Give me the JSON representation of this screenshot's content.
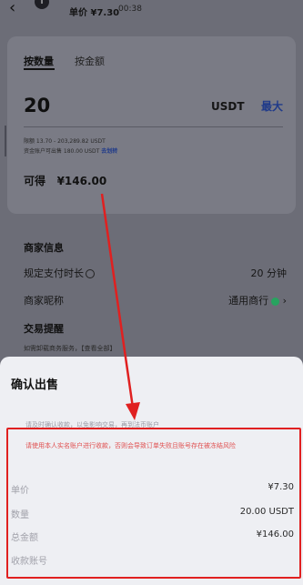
{
  "header": {
    "back_icon": "‹",
    "info_icon": "i",
    "unit_price": "单价 ¥7.30",
    "timer": "00:38"
  },
  "order_form": {
    "tabs": [
      "按数量",
      "按金额"
    ],
    "amount": "20",
    "currency": "USDT",
    "max_label": "最大",
    "limit_line": "限额 13.70 - 203,289.82 USDT",
    "available_line": "资金账户可出售 180.00 USDT",
    "available_link": "去划转",
    "receive_label": "可得",
    "receive_value": "¥146.00"
  },
  "merchant": {
    "section_title": "商家信息",
    "pay_time_label": "规定支付时长",
    "pay_time_value": "20 分钟",
    "nickname_label": "商家昵称",
    "nickname_value": "通用商行",
    "trade_tips_title": "交易提醒",
    "trade_tips_text": "如需卸载商务服务，【查看全部】"
  },
  "confirm_sheet": {
    "title": "确认出售",
    "faded_line": "请及时确认收款，以免影响交易，再到法币账户",
    "warning": "请使用本人实名账户进行收款，否则会导致订单失败且账号存在被冻结风险",
    "details": [
      {
        "label": "单价",
        "value": "¥7.30"
      },
      {
        "label": "数量",
        "value": "20.00 USDT"
      },
      {
        "label": "总金额",
        "value": "¥146.00"
      },
      {
        "label": "收款账号",
        "value": ""
      }
    ]
  },
  "colors": {
    "annotation_red": "#e02020",
    "overlay": "#6c6d77",
    "link_blue": "#1f3a8a"
  }
}
